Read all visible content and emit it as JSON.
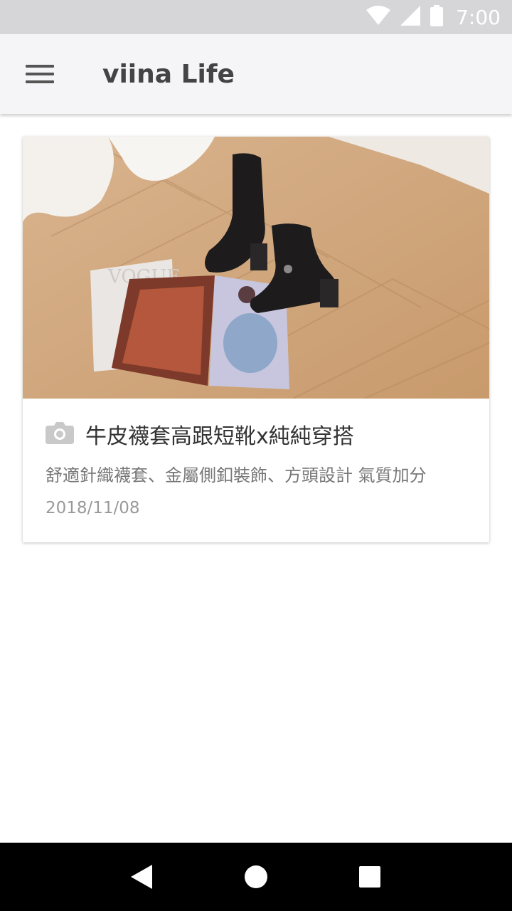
{
  "status_bar": {
    "time": "7:00",
    "icons": [
      "wifi-icon",
      "cell-signal-icon",
      "battery-icon"
    ]
  },
  "app_bar": {
    "title": "viina Life",
    "menu_icon": "hamburger-menu-icon"
  },
  "feed": {
    "items": [
      {
        "title": "牛皮襪套高跟短靴x純純穿搭",
        "subtitle": "舒適針織襪套、金屬側釦裝飾、方頭設計 氣質加分",
        "date": "2018/11/08",
        "type_icon": "camera-icon"
      }
    ]
  },
  "nav_bar": {
    "icons": [
      "back-icon",
      "home-icon",
      "recents-icon"
    ]
  },
  "colors": {
    "status_bar": "#d6d5d8",
    "app_bar": "#f5f4f7",
    "title_text": "#444444",
    "nav_bar": "#000000"
  }
}
